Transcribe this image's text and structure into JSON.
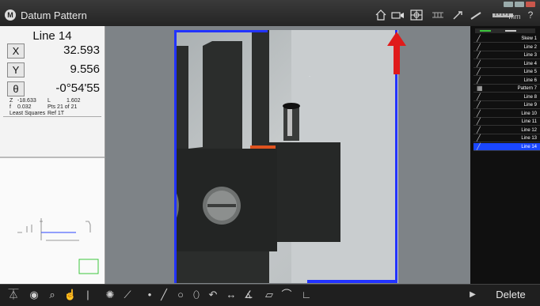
{
  "window": {
    "title": "Datum Pattern",
    "logo": "M"
  },
  "toolbar": {
    "units": "mm",
    "help": "?"
  },
  "readout": {
    "feature_name": "Line 14",
    "x_label": "X",
    "x_value": "32.593",
    "y_label": "Y",
    "y_value": "9.556",
    "theta_label": "θ",
    "theta_value": "-0°54'55",
    "z_label": "Z",
    "z_value": "-18.633",
    "l_label": "L",
    "l_value": "1.602",
    "f_label": "f",
    "f_value": "0.032",
    "pts": "Pts 21 of 21",
    "fit": "Least Squares",
    "ref": "Ref 1T"
  },
  "features": [
    {
      "label": "Skew 1",
      "selected": false
    },
    {
      "label": "Line 2",
      "selected": false
    },
    {
      "label": "Line 3",
      "selected": false
    },
    {
      "label": "Line 4",
      "selected": false
    },
    {
      "label": "Line 5",
      "selected": false
    },
    {
      "label": "Line 6",
      "selected": false
    },
    {
      "label": "Pattern 7",
      "selected": false
    },
    {
      "label": "Line 8",
      "selected": false
    },
    {
      "label": "Line 9",
      "selected": false
    },
    {
      "label": "Line 10",
      "selected": false
    },
    {
      "label": "Line 11",
      "selected": false
    },
    {
      "label": "Line 12",
      "selected": false
    },
    {
      "label": "Line 13",
      "selected": false
    },
    {
      "label": "Line 14",
      "selected": true
    }
  ],
  "bottom": {
    "delete_label": "Delete"
  },
  "colors": {
    "selection": "#1a47ff",
    "annotation_arrow": "#e01b1b",
    "edge_line": "#2233ff"
  }
}
